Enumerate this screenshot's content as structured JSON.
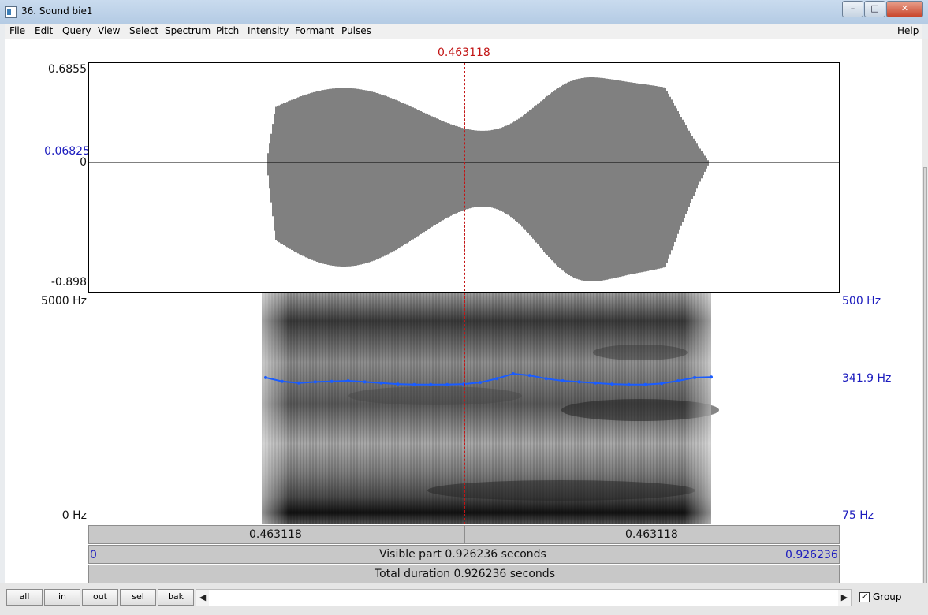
{
  "window": {
    "title": "36. Sound bie1"
  },
  "menu": [
    "File",
    "Edit",
    "Query",
    "View",
    "Select",
    "Spectrum",
    "Pitch",
    "Intensity",
    "Formant",
    "Pulses"
  ],
  "help_label": "Help",
  "cursor": {
    "time_label": "0.463118",
    "time": 0.463118
  },
  "waveform": {
    "max_label": "0.6855",
    "value_label": "0.06825",
    "zero_label": "0",
    "min_label": "-0.898"
  },
  "spectrogram": {
    "top_label": "5000 Hz",
    "bottom_label": "0 Hz"
  },
  "pitch": {
    "top_label": "500 Hz",
    "value_label": "341.9 Hz",
    "bottom_label": "75 Hz",
    "color": "#1a5cff",
    "contour_hz": [
      345,
      338,
      335,
      337,
      338,
      339,
      337,
      335,
      333,
      332,
      332,
      332,
      333,
      336,
      343,
      352,
      349,
      343,
      339,
      337,
      335,
      333,
      332,
      332,
      334,
      339,
      345,
      346
    ]
  },
  "time_bars": {
    "left_segment": "0.463118",
    "right_segment": "0.463118",
    "visible_start": "0",
    "visible_label": "Visible part 0.926236 seconds",
    "visible_end": "0.926236",
    "total_label": "Total duration 0.926236 seconds"
  },
  "toolbar": {
    "all": "all",
    "in": "in",
    "out": "out",
    "sel": "sel",
    "bak": "bak"
  },
  "group": {
    "label": "Group",
    "checked": true
  }
}
